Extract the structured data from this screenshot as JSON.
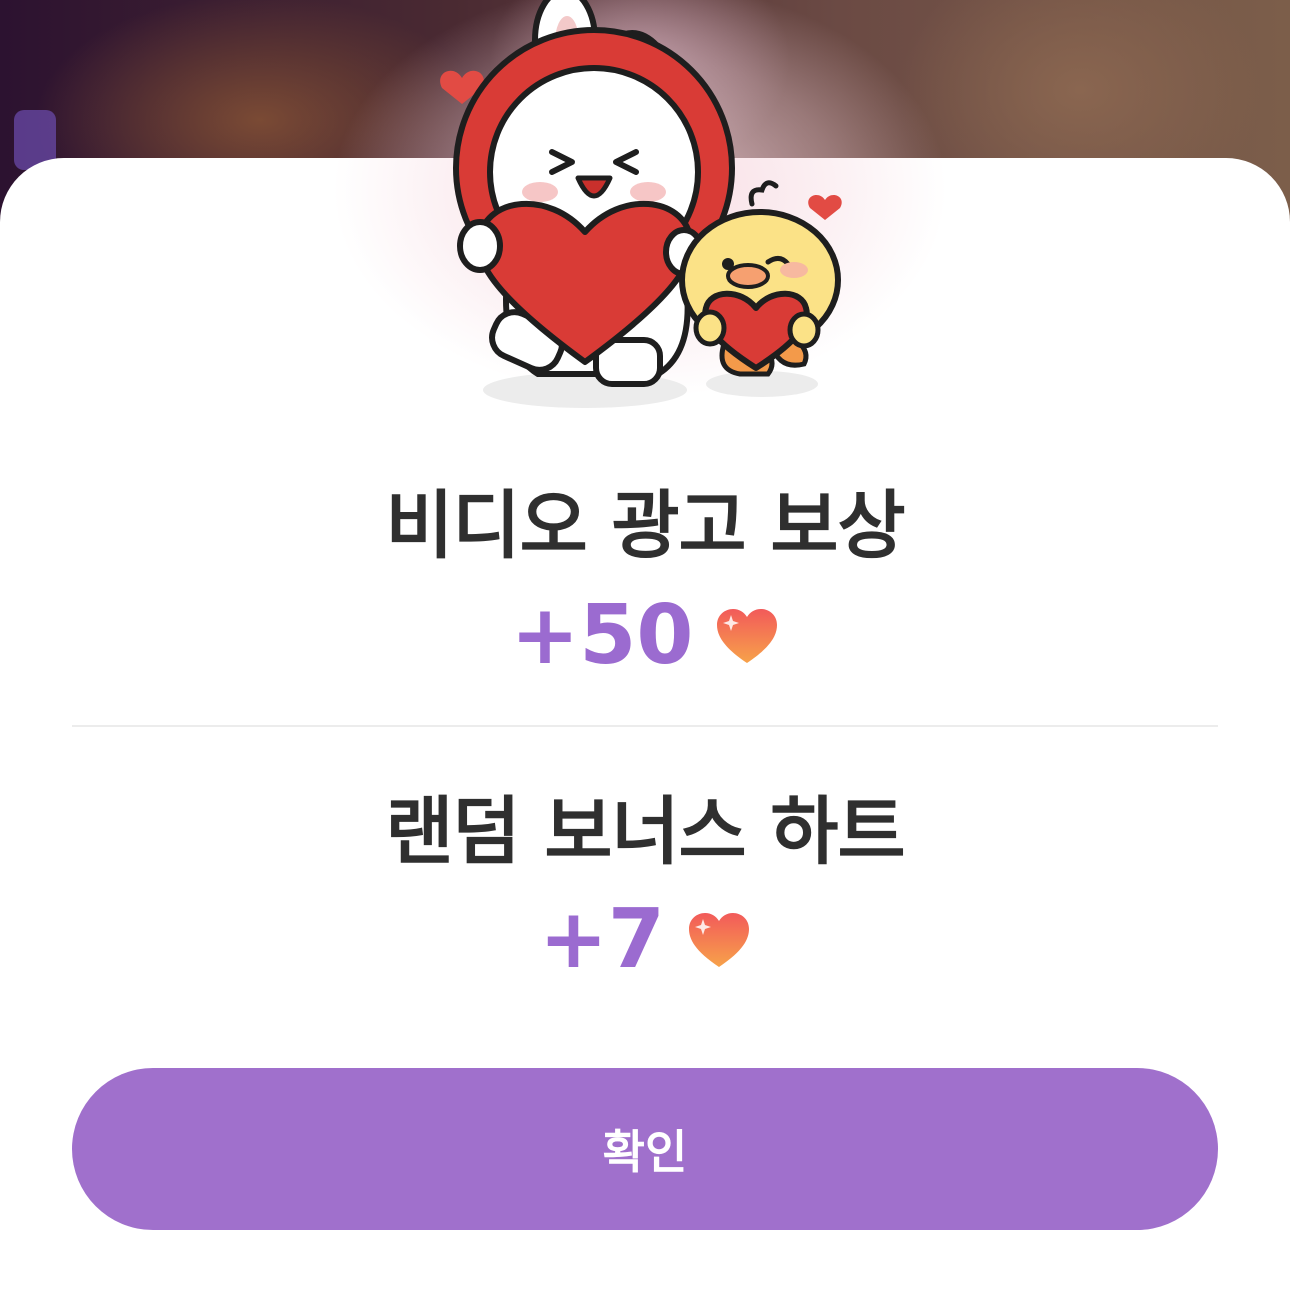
{
  "reward_popup": {
    "video_reward": {
      "title": "비디오 광고 보상",
      "amount": "+50"
    },
    "bonus_reward": {
      "title": "랜덤 보너스 하트",
      "amount": "+7"
    },
    "confirm_label": "확인"
  },
  "colors": {
    "accent": "#a070cc",
    "amount_text": "#9b6bd0",
    "heading_text": "#2f2f2f",
    "heart": "#f0604a"
  },
  "icons": {
    "reward_heart": "heart-icon",
    "illustration": "bunny-and-chick-holding-hearts"
  }
}
